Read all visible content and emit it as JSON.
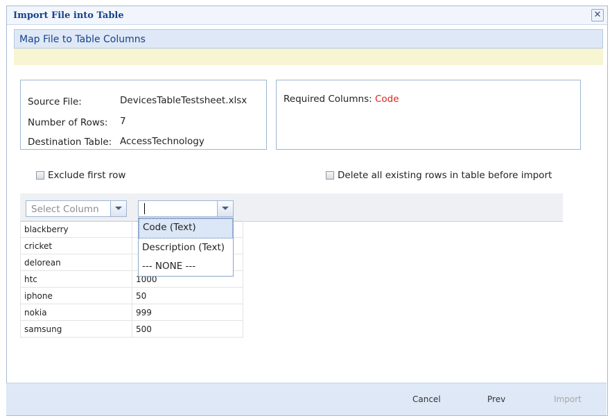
{
  "dialog": {
    "title": "Import File into Table",
    "close_glyph": "✕"
  },
  "step": {
    "title": "Map File to Table Columns"
  },
  "info": {
    "source_file_label": "Source File:",
    "source_file_value": "DevicesTableTestsheet.xlsx",
    "rows_label": "Number of Rows:",
    "rows_value": "7",
    "dest_label": "Destination Table:",
    "dest_value": "AccessTechnology"
  },
  "required": {
    "label": "Required Columns:",
    "value": "Code",
    "value_color": "#d9261c"
  },
  "options": {
    "exclude_first_row": "Exclude first row",
    "exclude_first_row_checked": false,
    "delete_existing": "Delete all existing rows in table before import",
    "delete_existing_checked": false
  },
  "mapping": {
    "col1_placeholder": "Select Column",
    "col2_value": ""
  },
  "dropdown": {
    "items": [
      "Code (Text)",
      "Description (Text)",
      "--- NONE ---"
    ],
    "highlighted_index": 0
  },
  "rows": [
    [
      "blackberry",
      ""
    ],
    [
      "cricket",
      ""
    ],
    [
      "delorean",
      ""
    ],
    [
      "htc",
      "1000"
    ],
    [
      "iphone",
      "50"
    ],
    [
      "nokia",
      "999"
    ],
    [
      "samsung",
      "500"
    ]
  ],
  "footer": {
    "cancel": "Cancel",
    "prev": "Prev",
    "import": "Import",
    "import_enabled": false
  },
  "icons": {
    "close": "close-icon",
    "dropdown_trigger": "chevron-down-icon",
    "checkbox": "checkbox-icon"
  },
  "colors": {
    "title": "#15428b",
    "header_bg": "#dfe8f6",
    "notice_bg": "#f8f5d2"
  }
}
